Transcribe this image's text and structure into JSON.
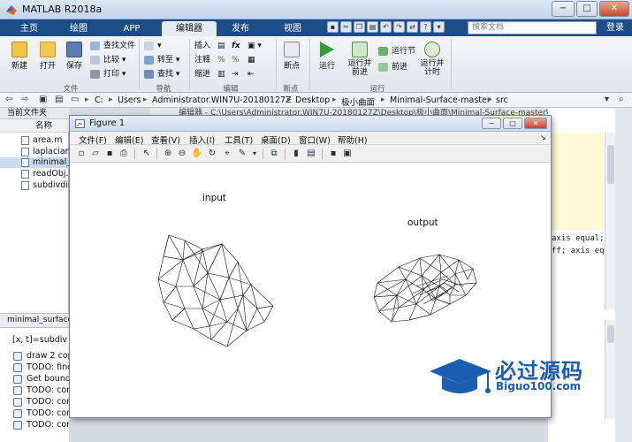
{
  "window": {
    "title": "MATLAB R2018a",
    "minimize": "−",
    "maximize": "□",
    "close": "✕"
  },
  "tabs": [
    "主页",
    "绘图",
    "APP",
    "编辑器",
    "发布",
    "视图"
  ],
  "search": {
    "placeholder": "搜索文档"
  },
  "login": "登录",
  "ribbon": {
    "file": {
      "new": "新建",
      "open": "打开",
      "save": "保存",
      "find_files": "查找文件",
      "compare": "比较",
      "print": "打印",
      "group": "文件"
    },
    "navigate": {
      "goto": "转至",
      "find": "查找",
      "group": "导航"
    },
    "edit": {
      "insert": "插入",
      "comment": "注释",
      "indent": "缩进",
      "group": "编辑"
    },
    "breakpoints": {
      "label": "断点",
      "group": "断点"
    },
    "run": {
      "run": "运行",
      "run_advance": "运行并前进",
      "run_section": "运行节",
      "advance": "前进",
      "run_time": "运行并计时",
      "group": "运行"
    }
  },
  "address": [
    "C:",
    "Users",
    "Administrator.WIN7U-20180127Z",
    "Desktop",
    "极小曲面",
    "Minimal-Surface-master",
    "src"
  ],
  "current_folder": {
    "title": "当前文件夹",
    "column": "名称",
    "files": [
      "area.m",
      "laplacian...",
      "minimal_s...",
      "readObj.m",
      "subdivdis..."
    ],
    "details": "minimal_surface..."
  },
  "command": {
    "line": "[x, t]=subdivdi...",
    "history": [
      "draw 2 cop...",
      "TODO: find...",
      "Get bound...",
      "TODO: con...",
      "TODO: con...",
      "TODO: con...",
      "TODO: con..."
    ]
  },
  "editor": {
    "tab_text": "编辑器 - C:\\Users\\Administrator.WIN7U-20180127Z\\Desktop\\极小曲面\\Minimal-Surface-master\\src\\minimal_surfa...",
    "code": [
      {
        "plain": "axis equal;",
        "kw": ""
      },
      {
        "plain": "ff; axis eq",
        "kw": ""
      }
    ]
  },
  "figure": {
    "title": "Figure 1",
    "menus": [
      "文件(F)",
      "编辑(E)",
      "查看(V)",
      "插入(I)",
      "工具(T)",
      "桌面(D)",
      "窗口(W)",
      "帮助(H)"
    ],
    "labels": {
      "input": "input",
      "output": "output"
    }
  },
  "watermark": {
    "title": "必过源码",
    "subtitle": "Biguo100.com"
  },
  "colors": {
    "tabstrip": "#1d4d86",
    "accent": "#1b5db0"
  }
}
